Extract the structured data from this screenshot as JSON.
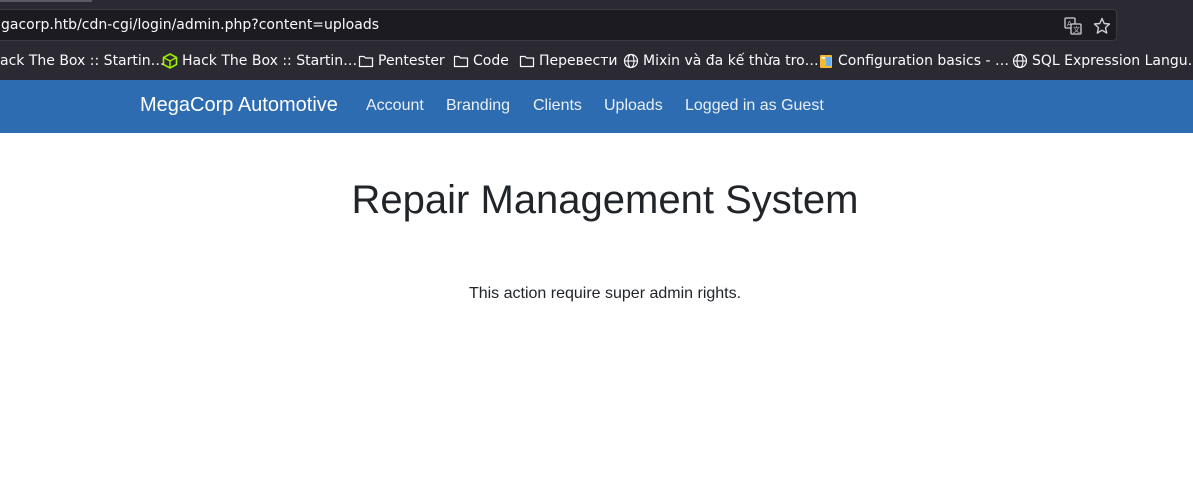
{
  "browser": {
    "url": "gacorp.htb/cdn-cgi/login/admin.php?content=uploads",
    "bookmarks": [
      {
        "label": "ack The Box :: Startin…",
        "icon": "none"
      },
      {
        "label": "Hack The Box :: Startin…",
        "icon": "htb-cube-icon"
      },
      {
        "label": "Pentester",
        "icon": "folder-icon"
      },
      {
        "label": "Code",
        "icon": "folder-icon"
      },
      {
        "label": "Перевести",
        "icon": "folder-icon"
      },
      {
        "label": "Mixin và đa kế thừa tro…",
        "icon": "globe-icon"
      },
      {
        "label": "Configuration basics - …",
        "icon": "docs-icon"
      },
      {
        "label": "SQL Expression Langu…",
        "icon": "globe-icon"
      }
    ]
  },
  "navbar": {
    "brand": "MegaCorp Automotive",
    "links": [
      "Account",
      "Branding",
      "Clients",
      "Uploads",
      "Logged in as Guest"
    ],
    "color": "#2d6cb0"
  },
  "main": {
    "title": "Repair Management System",
    "message": "This action require super admin rights."
  }
}
